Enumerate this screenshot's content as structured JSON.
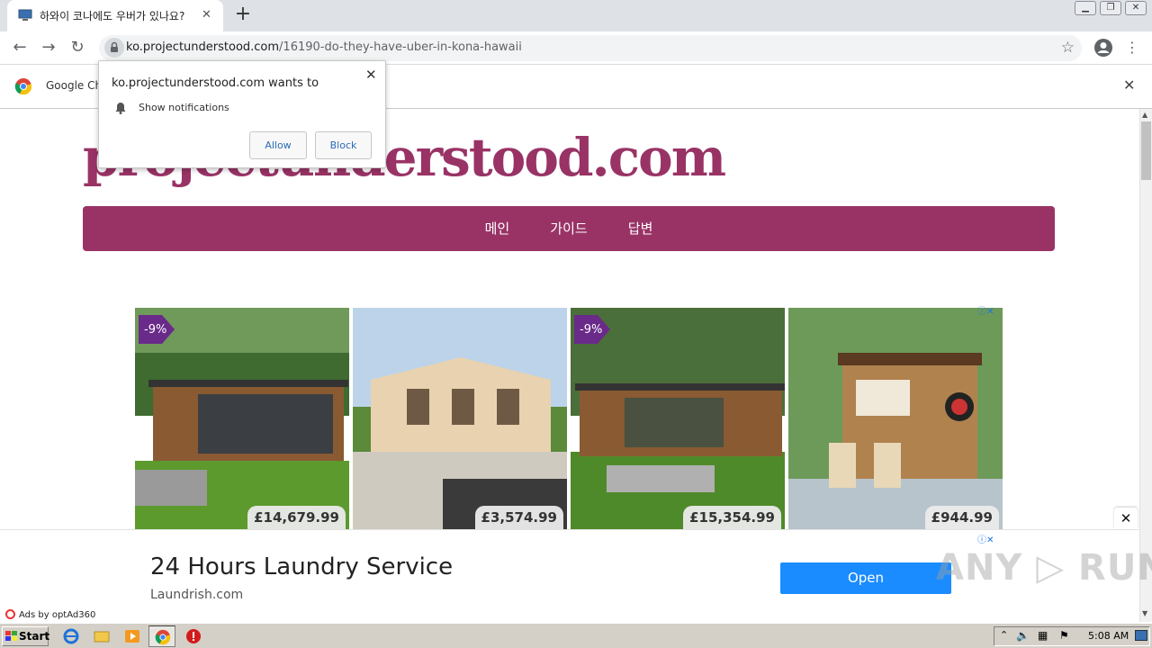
{
  "browser": {
    "tab_title": "하와이 코나에도 우버가 있나요?",
    "tab_close": "✕",
    "new_tab": "+",
    "url_domain": "ko.projectunderstood.com",
    "url_path": "/16190-do-they-have-uber-in-kona-hawaii",
    "nav_back": "←",
    "nav_forward": "→",
    "nav_reload": "↻",
    "bookmark_star": "☆",
    "menu_dots": "⋮",
    "window_buttons": [
      "▁",
      "❐",
      "✕"
    ]
  },
  "infobar": {
    "text": "Google Ch",
    "close": "✕"
  },
  "notification_prompt": {
    "message": "ko.projectunderstood.com wants to",
    "permission": "Show notifications",
    "close": "✕",
    "allow_label": "Allow",
    "block_label": "Block"
  },
  "site": {
    "title": "projectunderstood.com",
    "nav": [
      "메인",
      "가이드",
      "답변"
    ]
  },
  "product_ad": {
    "adchoices": "ⓘ✕",
    "items": [
      {
        "price": "£14,679.99",
        "badge": "-9%"
      },
      {
        "price": "£3,574.99",
        "badge": ""
      },
      {
        "price": "£15,354.99",
        "badge": "-9%"
      },
      {
        "price": "£944.99",
        "badge": ""
      }
    ]
  },
  "bottom_ad": {
    "close": "✕",
    "headline": "24 Hours Laundry Service",
    "domain": "Laundrish.com",
    "cta": "Open",
    "ads_by": "Ads by optAd360",
    "adchoices": "ⓘ✕"
  },
  "watermark": "ANY ▷ RUN",
  "taskbar": {
    "start_label": "Start",
    "clock": "5:08 AM"
  },
  "colors": {
    "brand": "#993366",
    "cta": "#1a8cff"
  }
}
